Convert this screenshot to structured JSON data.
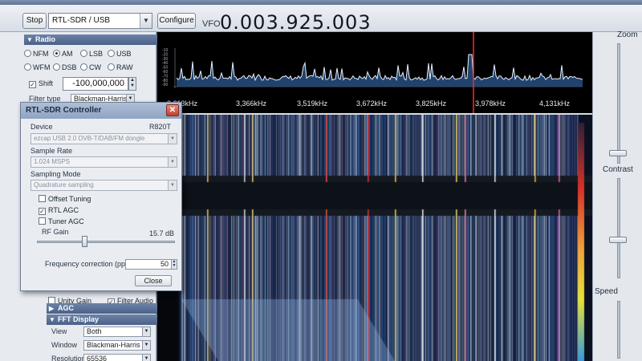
{
  "toolbar": {
    "stop_label": "Stop",
    "source_value": "RTL-SDR / USB",
    "configure_label": "Configure",
    "vfo_label": "VFO",
    "vfo_value": "0.003.925.003"
  },
  "radio_section": {
    "title": "Radio",
    "modes_row1": [
      "NFM",
      "AM",
      "LSB",
      "USB"
    ],
    "modes_row2": [
      "WFM",
      "DSB",
      "CW",
      "RAW"
    ],
    "selected_mode": "AM",
    "shift_label": "Shift",
    "shift_checked": true,
    "shift_value": "-100,000,000",
    "filter_type_label": "Filter type",
    "filter_type_value": "Blackman-Harris"
  },
  "bottom_panel": {
    "unity_gain_label": "Unity Gain",
    "filter_audio_label": "Filter Audio",
    "filter_audio_checked": true,
    "agc_title": "AGC",
    "fft_title": "FFT Display",
    "view_label": "View",
    "view_value": "Both",
    "window_label": "Window",
    "window_value": "Blackman-Harris",
    "resolution_label": "Resolution",
    "resolution_value": "65536"
  },
  "spectrum": {
    "freq_labels": [
      "3,213kHz",
      "3,366kHz",
      "3,519kHz",
      "3,672kHz",
      "3,825kHz",
      "3,978kHz",
      "4,131kHz"
    ],
    "db_labels": [
      "-10",
      "-20",
      "-30",
      "-40",
      "-50",
      "-60",
      "-70",
      "-80",
      "-90"
    ]
  },
  "right_panel": {
    "zoom_label": "Zoom",
    "contrast_label": "Contrast",
    "speed_label": "Speed"
  },
  "dialog": {
    "title": "RTL-SDR Controller",
    "device_label": "Device",
    "device_model": "R820T",
    "device_value": "ezcap USB 2.0 DVB-T/DAB/FM dongle",
    "sample_rate_label": "Sample Rate",
    "sample_rate_value": "1.024 MSPS",
    "sampling_mode_label": "Sampling Mode",
    "sampling_mode_value": "Quadrature sampling",
    "offset_tuning_label": "Offset Tuning",
    "offset_tuning_checked": false,
    "rtl_agc_label": "RTL AGC",
    "rtl_agc_checked": true,
    "tuner_agc_label": "Tuner AGC",
    "tuner_agc_checked": false,
    "rf_gain_label": "RF Gain",
    "rf_gain_value": "15.7 dB",
    "freq_correction_label": "Frequency correction (ppm)",
    "freq_correction_value": "50",
    "close_label": "Close"
  },
  "colors": {
    "accent": "#4a6088",
    "spectrum_line": "#e8eef8",
    "marker": "#ff2a2a"
  }
}
